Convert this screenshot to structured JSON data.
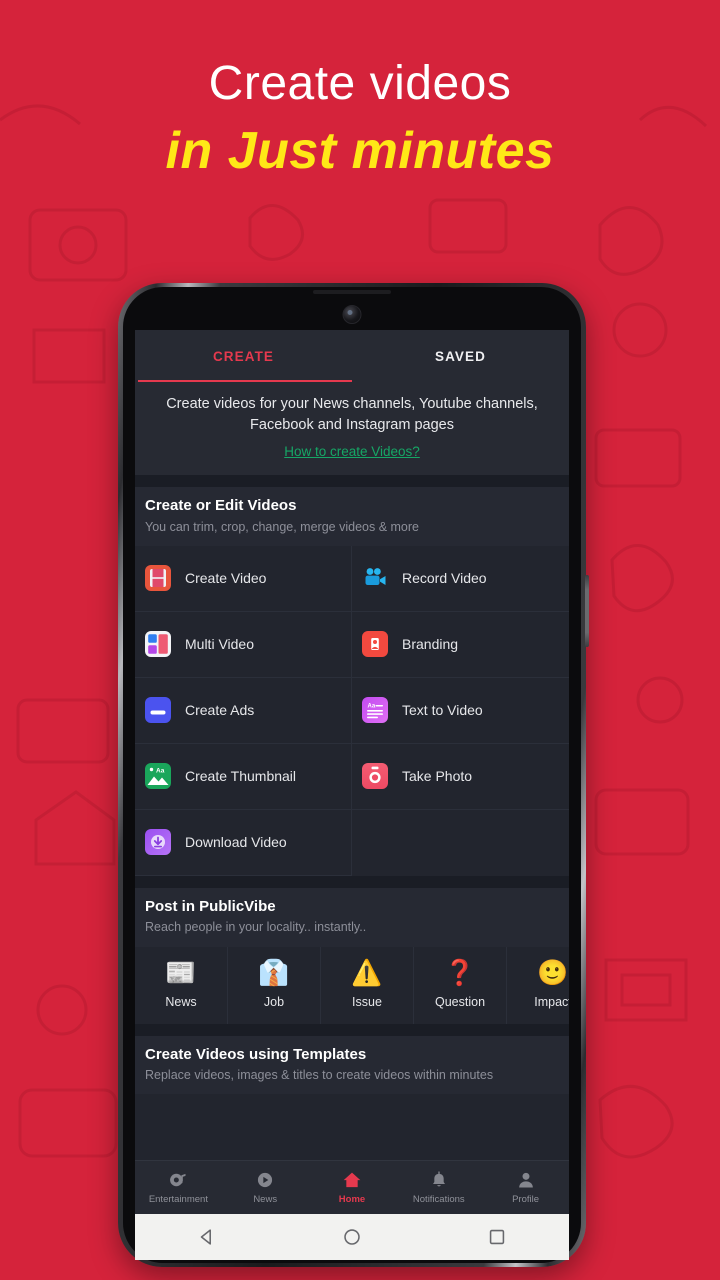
{
  "promo": {
    "headline_line1": "Create videos",
    "headline_line2": "in Just minutes",
    "bg_color": "#d5233b",
    "headline_accent_color": "#ffe817"
  },
  "app": {
    "tabs": [
      {
        "label": "CREATE",
        "active": true
      },
      {
        "label": "SAVED",
        "active": false
      }
    ],
    "intro": {
      "text": "Create videos for your News channels, Youtube channels, Facebook and Instagram pages",
      "link": "How to create Videos?",
      "link_color": "#16a766"
    },
    "sections": [
      {
        "title": "Create or Edit Videos",
        "subtitle": "You can trim, crop, change, merge videos & more",
        "items": [
          {
            "label": "Create Video",
            "icon": "film-strip-icon"
          },
          {
            "label": "Record Video",
            "icon": "video-camera-icon"
          },
          {
            "label": "Multi Video",
            "icon": "grid-tiles-icon"
          },
          {
            "label": "Branding",
            "icon": "branding-badge-icon"
          },
          {
            "label": "Create Ads",
            "icon": "ads-banner-icon"
          },
          {
            "label": "Text to Video",
            "icon": "text-lines-icon"
          },
          {
            "label": "Create Thumbnail",
            "icon": "thumbnail-image-icon"
          },
          {
            "label": "Take Photo",
            "icon": "camera-icon"
          },
          {
            "label": "Download Video",
            "icon": "download-cloud-icon"
          }
        ]
      },
      {
        "title": "Post in PublicVibe",
        "subtitle": "Reach people in your locality.. instantly..",
        "chips": [
          {
            "label": "News",
            "emoji": "📰",
            "icon": "newspaper-icon"
          },
          {
            "label": "Job",
            "emoji": "👔",
            "icon": "necktie-icon"
          },
          {
            "label": "Issue",
            "emoji": "⚠️",
            "icon": "warning-icon"
          },
          {
            "label": "Question",
            "emoji": "❓",
            "icon": "question-icon"
          },
          {
            "label": "Impact",
            "emoji": "🙂",
            "icon": "smiley-icon"
          }
        ]
      },
      {
        "title": "Create Videos using Templates",
        "subtitle": "Replace videos, images & titles to create videos within minutes"
      }
    ],
    "bottom_nav": [
      {
        "label": "Entertainment",
        "icon": "entertainment-icon",
        "active": false
      },
      {
        "label": "News",
        "icon": "play-circle-icon",
        "active": false
      },
      {
        "label": "Home",
        "icon": "home-icon",
        "active": true
      },
      {
        "label": "Notifications",
        "icon": "bell-icon",
        "active": false
      },
      {
        "label": "Profile",
        "icon": "person-icon",
        "active": false
      }
    ],
    "accent_color": "#e5394e"
  },
  "system_nav": {
    "back": "back-triangle-icon",
    "home": "home-circle-icon",
    "recents": "recents-square-icon"
  }
}
